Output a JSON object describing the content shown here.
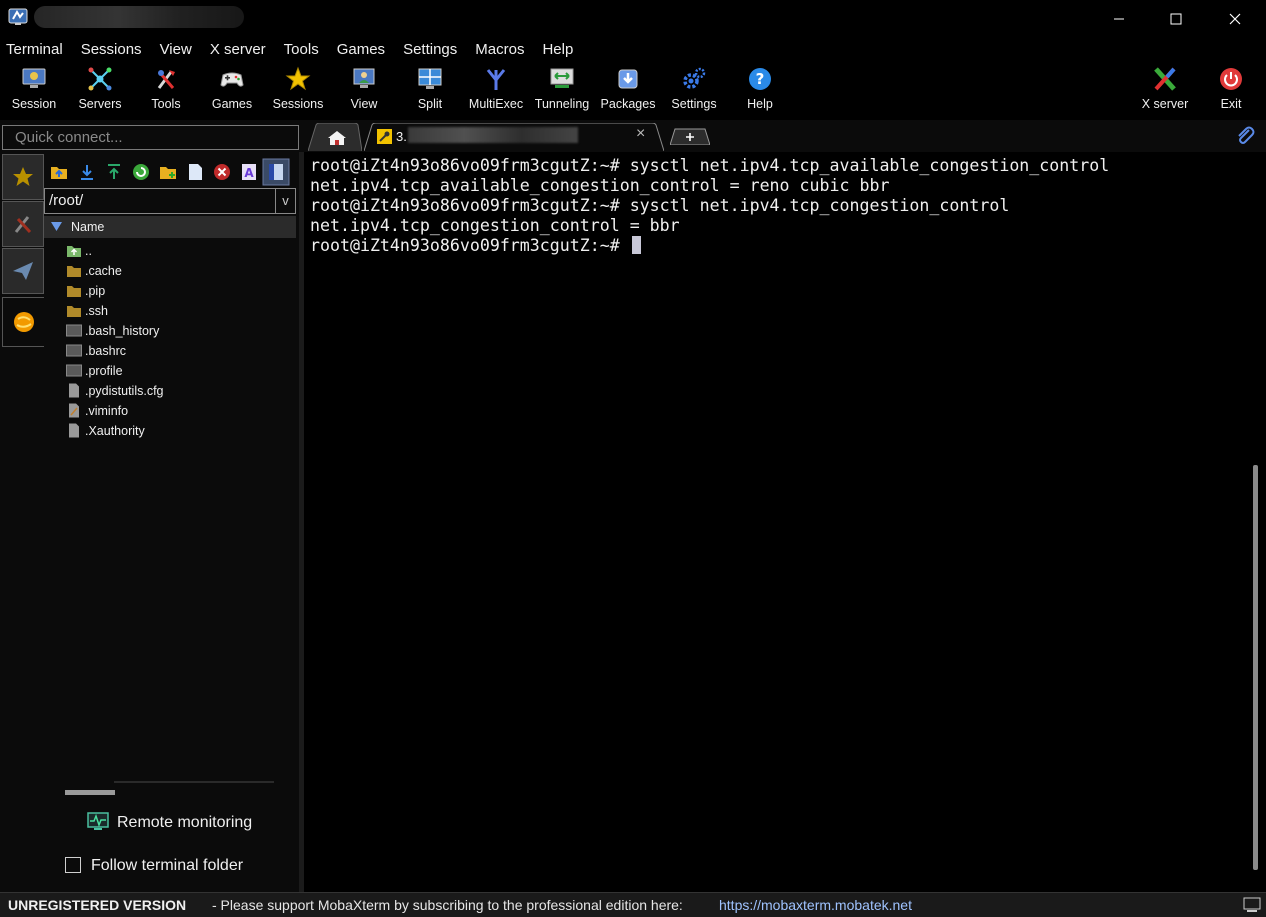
{
  "window": {
    "minimize_label": "minimize",
    "maximize_label": "maximize",
    "close_label": "close"
  },
  "menu": [
    "Terminal",
    "Sessions",
    "View",
    "X server",
    "Tools",
    "Games",
    "Settings",
    "Macros",
    "Help"
  ],
  "toolbar": {
    "session": "Session",
    "servers": "Servers",
    "tools": "Tools",
    "games": "Games",
    "sessions": "Sessions",
    "view": "View",
    "split": "Split",
    "multiexec": "MultiExec",
    "tunneling": "Tunneling",
    "packages": "Packages",
    "settings": "Settings",
    "help": "Help",
    "xserver": "X server",
    "exit": "Exit"
  },
  "quick_connect": {
    "placeholder": "Quick connect..."
  },
  "tabs": {
    "session_prefix": "3."
  },
  "sftp": {
    "path": "/root/",
    "column_name": "Name",
    "files": [
      "..",
      ".cache",
      ".pip",
      ".ssh",
      ".bash_history",
      ".bashrc",
      ".profile",
      ".pydistutils.cfg",
      ".viminfo",
      ".Xauthority"
    ],
    "remote_monitoring": "Remote monitoring",
    "follow_folder": "Follow terminal folder",
    "follow_checked": false
  },
  "terminal": {
    "lines": [
      "root@iZt4n93o86vo09frm3cgutZ:~# sysctl net.ipv4.tcp_available_congestion_control",
      "net.ipv4.tcp_available_congestion_control = reno cubic bbr",
      "root@iZt4n93o86vo09frm3cgutZ:~# sysctl net.ipv4.tcp_congestion_control",
      "net.ipv4.tcp_congestion_control = bbr",
      "root@iZt4n93o86vo09frm3cgutZ:~# "
    ]
  },
  "status": {
    "unregistered": "UNREGISTERED VERSION",
    "message": "-  Please support MobaXterm by subscribing to the professional edition here:",
    "link": "https://mobaxterm.mobatek.net"
  },
  "colors": {
    "background": "#000000",
    "terminal_text": "#f0f0f0",
    "link": "#9fc3ff",
    "accent_star": "#f2c200"
  }
}
